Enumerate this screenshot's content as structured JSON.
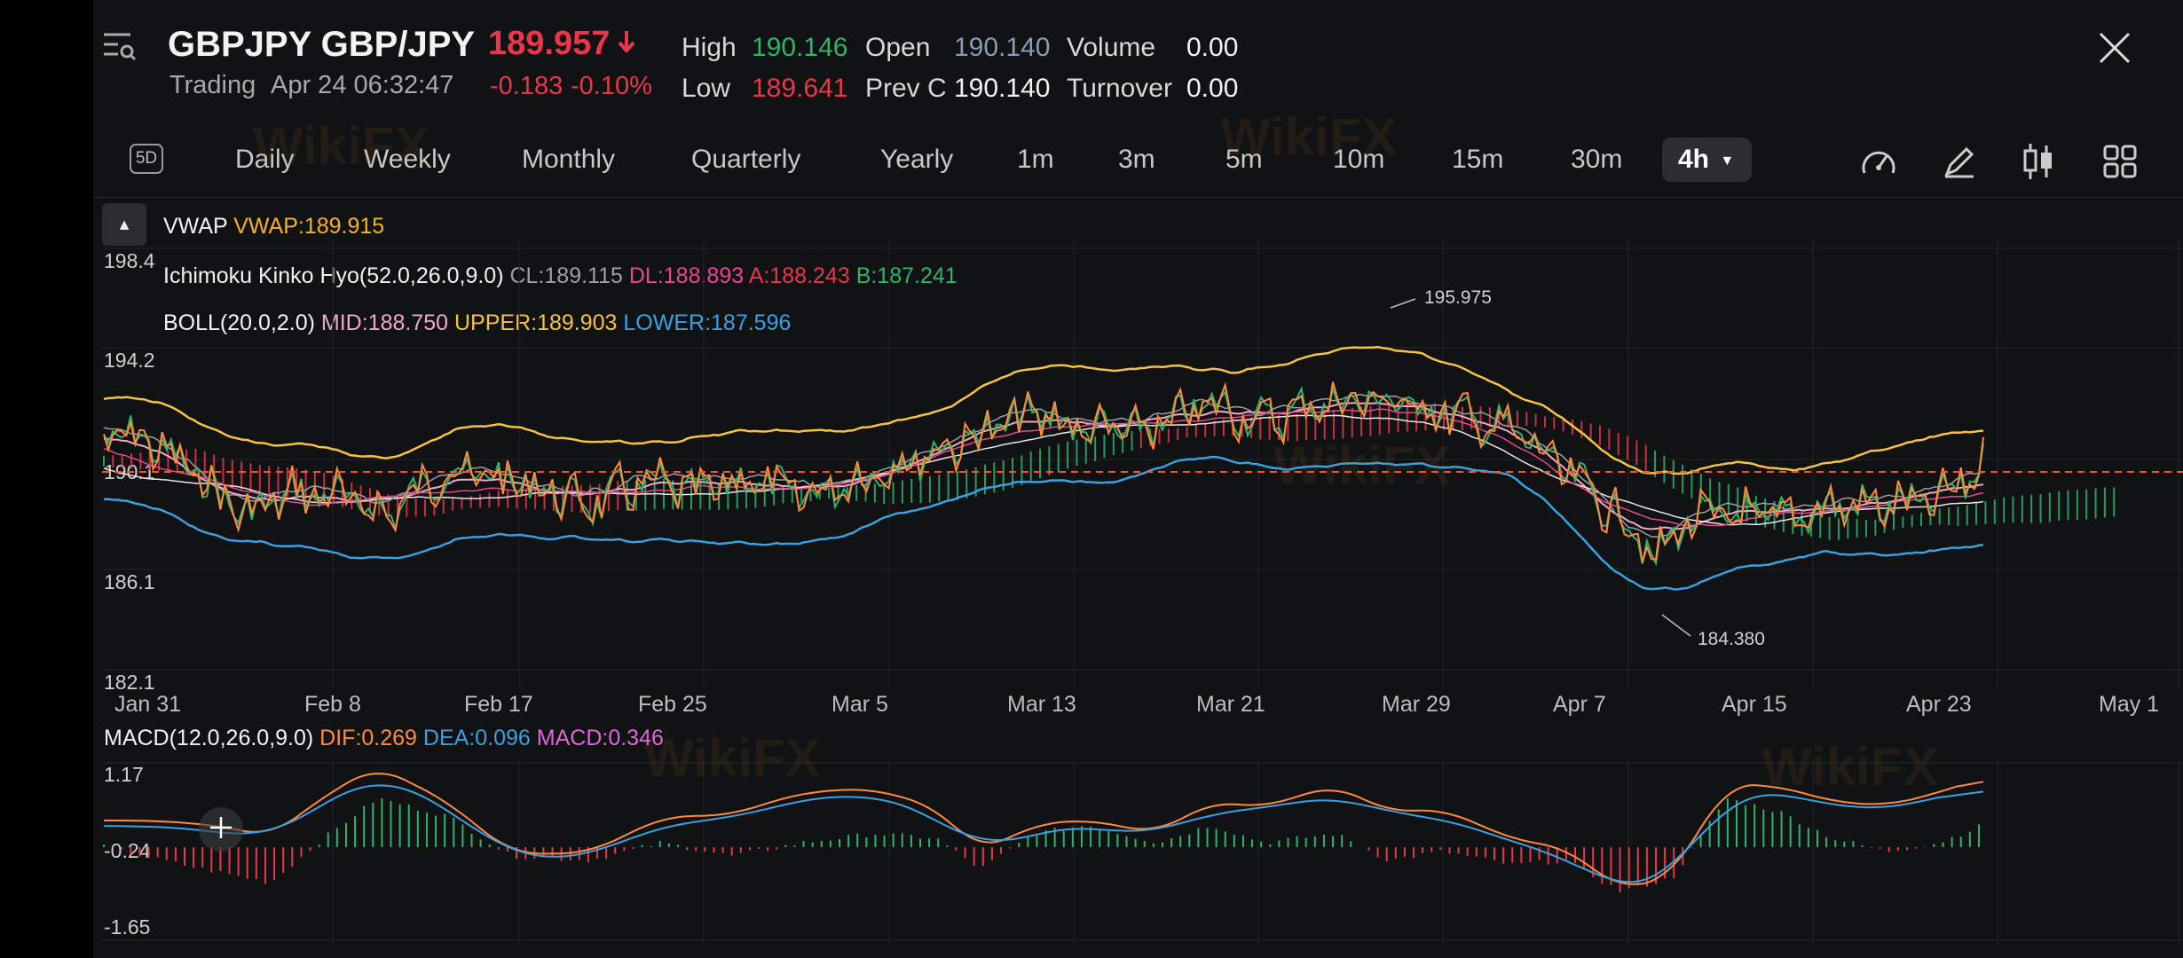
{
  "header": {
    "symbol": "GBPJPY GBP/JPY",
    "status": "Trading",
    "time": "Apr 24 06:32:47",
    "price": "189.957",
    "change": "-0.183",
    "change_pct": "-0.10%",
    "stats": [
      {
        "label": "High",
        "value": "190.146",
        "color": "#2fb36b"
      },
      {
        "label": "Low",
        "value": "189.641",
        "color": "#e8374b"
      },
      {
        "label": "Open",
        "value": "190.140",
        "color": "#8b9bb4"
      },
      {
        "label": "Prev C",
        "value": "190.140",
        "color": "#f2f2f2"
      },
      {
        "label": "Volume",
        "value": "0.00",
        "color": "#f2f2f2"
      },
      {
        "label": "Turnover",
        "value": "0.00",
        "color": "#f2f2f2"
      }
    ]
  },
  "toolbar": {
    "fivedays_label": "5D",
    "tabs": [
      "Daily",
      "Weekly",
      "Monthly",
      "Quarterly",
      "Yearly",
      "1m",
      "3m",
      "5m",
      "10m",
      "15m",
      "30m",
      "4h"
    ],
    "active_tab": "4h"
  },
  "indicators": {
    "vwap": {
      "name": "VWAP",
      "value": "VWAP:189.915"
    },
    "ichimoku": {
      "name": "Ichimoku Kinko Hyo(52.0,26.0,9.0)",
      "cl": "CL:189.115",
      "dl": "DL:188.893",
      "a": "A:188.243",
      "b": "B:187.241"
    },
    "boll": {
      "name": "BOLL(20.0,2.0)",
      "mid": "MID:188.750",
      "upper": "UPPER:189.903",
      "lower": "LOWER:187.596"
    },
    "macd": {
      "name": "MACD(12.0,26.0,9.0)",
      "dif": "DIF:0.269",
      "dea": "DEA:0.096",
      "macd": "MACD:0.346"
    }
  },
  "colors": {
    "up": "#2fb36b",
    "down": "#e8374b",
    "vwap": "#f5b324",
    "cl": "#9aa0a6",
    "dl": "#e8468f",
    "a": "#e8374b",
    "b": "#2fb36b",
    "mid": "#f0a8c8",
    "upper": "#f5c242",
    "lower": "#3aa0e0",
    "dif": "#ff8a3d",
    "dea": "#3aa0e0",
    "macd": "#e066d8",
    "lastline": "#e85a2a"
  },
  "price_axis": [
    "198.4",
    "194.2",
    "190.1",
    "186.1",
    "182.1"
  ],
  "macd_axis": [
    "1.17",
    "-0.24",
    "-1.65"
  ],
  "date_axis": [
    "Jan 31",
    "Feb 8",
    "Feb 17",
    "Feb 25",
    "Mar 5",
    "Mar 13",
    "Mar 21",
    "Mar 29",
    "Apr 7",
    "Apr 15",
    "Apr 23",
    "May 1"
  ],
  "annotations": {
    "high": "195.975",
    "low": "184.380"
  },
  "watermark": "WikiFX"
}
